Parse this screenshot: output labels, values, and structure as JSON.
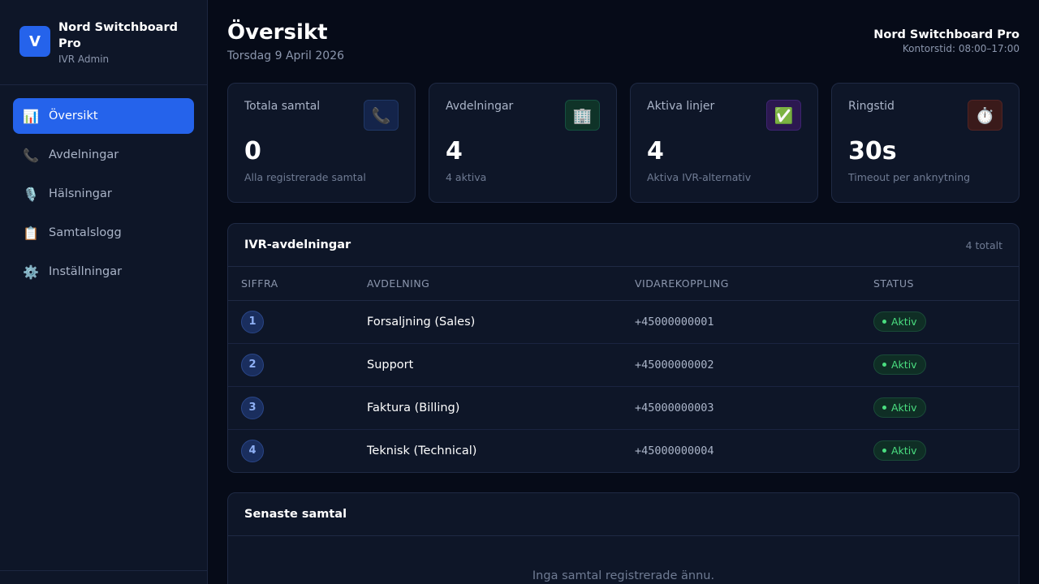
{
  "brand": {
    "logo_letter": "V",
    "name": "Nord Switchboard Pro",
    "subtitle": "IVR Admin"
  },
  "nav": [
    {
      "icon": "📊",
      "label": "Översikt",
      "active": true
    },
    {
      "icon": "📞",
      "label": "Avdelningar"
    },
    {
      "icon": "🎙️",
      "label": "Hälsningar"
    },
    {
      "icon": "📋",
      "label": "Samtalslogg"
    },
    {
      "icon": "⚙️",
      "label": "Inställningar"
    }
  ],
  "header": {
    "title": "Översikt",
    "date": "Torsdag 9 April 2026",
    "company": "Nord Switchboard Pro",
    "office_hours": "Kontorstid: 08:00–17:00"
  },
  "stats": [
    {
      "label": "Totala samtal",
      "icon": "📞",
      "value": "0",
      "sub": "Alla registrerade samtal"
    },
    {
      "label": "Avdelningar",
      "icon": "🏢",
      "value": "4",
      "sub": "4 aktiva"
    },
    {
      "label": "Aktiva linjer",
      "icon": "✅",
      "value": "4",
      "sub": "Aktiva IVR-alternativ"
    },
    {
      "label": "Ringstid",
      "icon": "⏱️",
      "value": "30s",
      "sub": "Timeout per anknytning"
    }
  ],
  "departments_panel": {
    "title": "IVR-avdelningar",
    "count": "4 totalt",
    "columns": [
      "SIFFRA",
      "AVDELNING",
      "VIDAREKOPPLING",
      "STATUS"
    ],
    "rows": [
      {
        "digit": "1",
        "name": "Forsaljning (Sales)",
        "forward": "+45000000001",
        "status": "Aktiv"
      },
      {
        "digit": "2",
        "name": "Support",
        "forward": "+45000000002",
        "status": "Aktiv"
      },
      {
        "digit": "3",
        "name": "Faktura (Billing)",
        "forward": "+45000000003",
        "status": "Aktiv"
      },
      {
        "digit": "4",
        "name": "Teknisk (Technical)",
        "forward": "+45000000004",
        "status": "Aktiv"
      }
    ]
  },
  "recent_calls_panel": {
    "title": "Senaste samtal",
    "empty_text": "Inga samtal registrerade ännu."
  }
}
